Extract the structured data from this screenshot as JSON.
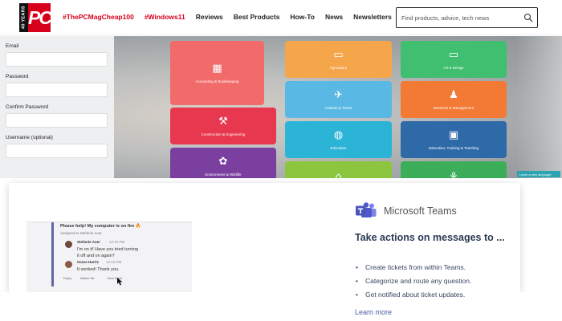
{
  "header": {
    "logo_years": "40 YEARS",
    "logo_text": "PC",
    "nav_tags": [
      "#ThePCMagCheap100",
      "#Windows11"
    ],
    "nav_links": [
      "Reviews",
      "Best Products",
      "How-To",
      "News",
      "Newsletters"
    ],
    "search_placeholder": "Find products, advice, tech news"
  },
  "form": {
    "fields": [
      {
        "label": "Email",
        "value": ""
      },
      {
        "label": "Password",
        "value": ""
      },
      {
        "label": "Confirm Password",
        "value": ""
      },
      {
        "label": "Username (optional)",
        "value": ""
      }
    ]
  },
  "categories": [
    {
      "label": "Accounting & Bookkeeping",
      "color": "#f26b6b",
      "icon": "calculator-icon",
      "glyph": "▦"
    },
    {
      "label": "Agriculture",
      "color": "#f5a54a",
      "icon": "tractor-icon",
      "glyph": "▭"
    },
    {
      "label": "Art & Design",
      "color": "#3fbf6f",
      "icon": "monitor-icon",
      "glyph": "▭"
    },
    {
      "label": "Aviation & Travel",
      "color": "#5ab9e4",
      "icon": "airplane-icon",
      "glyph": "✈"
    },
    {
      "label": "Business & Management",
      "color": "#f27a35",
      "icon": "people-icon",
      "glyph": "♟"
    },
    {
      "label": "Construction & Engineering",
      "color": "#e8384f",
      "icon": "tools-icon",
      "glyph": "⚒"
    },
    {
      "label": "Education",
      "color": "#2cb4d6",
      "icon": "globe-icon",
      "glyph": "◍"
    },
    {
      "label": "Education, Training & Teaching",
      "color": "#2f6aa8",
      "icon": "presentation-icon",
      "glyph": "▣"
    },
    {
      "label": "Environment & Wildlife",
      "color": "#7b3fa0",
      "icon": "leaf-icon",
      "glyph": "✿"
    },
    {
      "label": "",
      "color": "#8cc63f",
      "icon": "house-icon",
      "glyph": "⌂"
    },
    {
      "label": "",
      "color": "#3cae5a",
      "icon": "runner-icon",
      "glyph": "⚘"
    }
  ],
  "hero_tag": "Learn a new language",
  "ad": {
    "brand": "Microsoft Teams",
    "heading": "Take actions on messages to ...",
    "bullets": [
      "Create tickets from within Teams.",
      "Categorize and route any question.",
      "Get notified about ticket updates."
    ],
    "cta": "Learn more",
    "mock": {
      "title": "Please help! My computer is on fire 🔥",
      "assigned": "Assigned to Stefanie Auer",
      "msg1_name": "Stefanie Auer",
      "msg1_time": "12:12 PM",
      "msg1_line1": "I'm on it! Have you tried turning",
      "msg1_line2": "it off and on again?",
      "msg2_name": "Grace Harris",
      "msg2_time": "12:13 PM",
      "msg2_line1": "It worked! Thank you.",
      "actions": [
        "Reply",
        "Attach file",
        "View ticket"
      ]
    }
  }
}
